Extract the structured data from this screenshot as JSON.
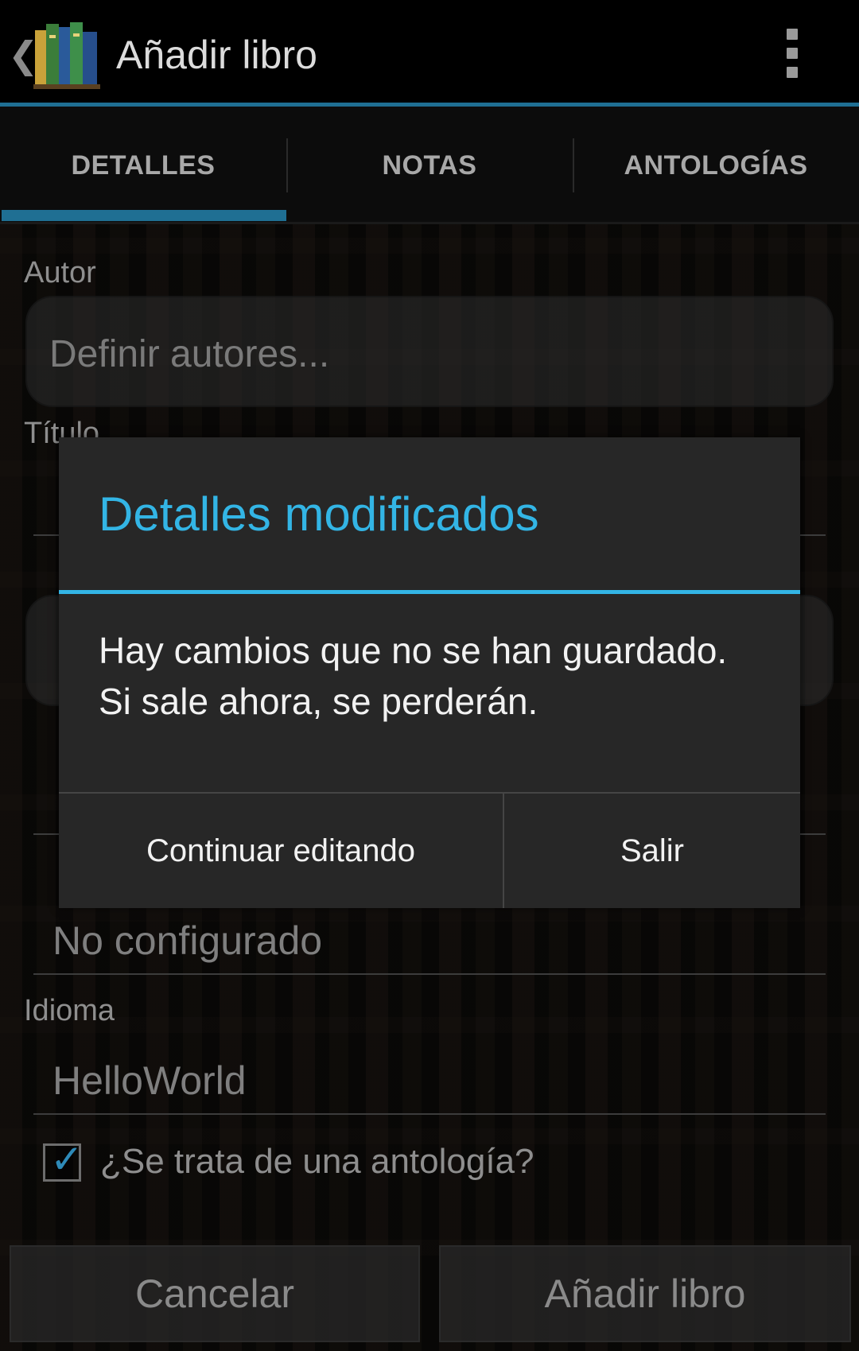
{
  "actionbar": {
    "up_icon": "chevron-left-icon",
    "logo_icon": "books-logo-icon",
    "title": "Añadir libro",
    "overflow_icon": "overflow-menu-icon"
  },
  "tabs": [
    {
      "label": "DETALLES",
      "selected": true
    },
    {
      "label": "NOTAS",
      "selected": false
    },
    {
      "label": "ANTOLOGÍAS",
      "selected": false
    }
  ],
  "form": {
    "author_label": "Autor",
    "author_placeholder": "Definir autores...",
    "title_label": "Título",
    "genre_value": "No configurado",
    "language_label": "Idioma",
    "language_value": "HelloWorld",
    "anthology_label": "¿Se trata de una antología?",
    "anthology_checked": true
  },
  "bottom_buttons": {
    "cancel": "Cancelar",
    "add": "Añadir libro"
  },
  "dialog": {
    "title": "Detalles modificados",
    "message": "Hay cambios que no se han guardado. Si sale ahora, se perderán.",
    "continue_label": "Continuar editando",
    "exit_label": "Salir"
  },
  "colors": {
    "accent": "#33b5e5",
    "tab_indicator": "#1f6f93",
    "dialog_bg": "#272727"
  }
}
